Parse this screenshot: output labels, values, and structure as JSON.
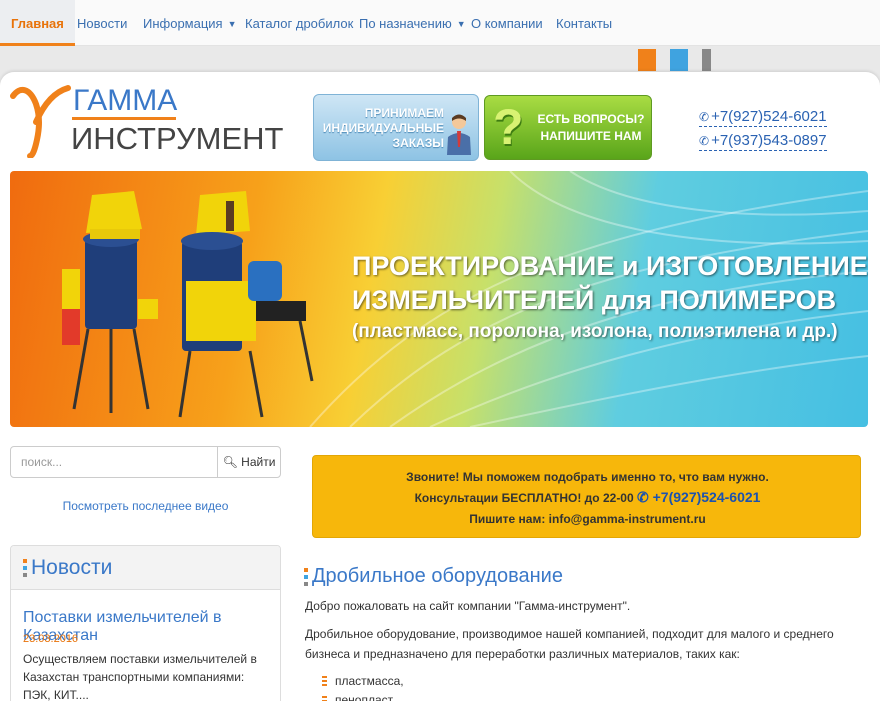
{
  "nav": {
    "items": [
      {
        "label": "Главная",
        "active": true
      },
      {
        "label": "Новости"
      },
      {
        "label": "Информация",
        "dropdown": true
      },
      {
        "label": "Каталог дробилок"
      },
      {
        "label": "По назначению",
        "dropdown": true
      },
      {
        "label": "О компании"
      },
      {
        "label": "Контакты"
      }
    ]
  },
  "logo": {
    "line1": "ГАММА",
    "line2": "ИНСТРУМЕНТ"
  },
  "header_banners": {
    "orders": {
      "line1": "ПРИНИМАЕМ",
      "line2": "ИНДИВИДУАЛЬНЫЕ",
      "line3": "ЗАКАЗЫ"
    },
    "questions": {
      "line1": "ЕСТЬ ВОПРОСЫ?",
      "line2": "НАПИШИТЕ НАМ"
    }
  },
  "phones": [
    "+7(927)524-6021",
    "+7(937)543-0897"
  ],
  "hero": {
    "line1": "ПРОЕКТИРОВАНИЕ и ИЗГОТОВЛЕНИЕ",
    "line2": "ИЗМЕЛЬЧИТЕЛЕЙ для ПОЛИМЕРОВ",
    "line3": "(пластмасс, поролона, изолона, полиэтилена и др.)"
  },
  "search": {
    "placeholder": "поиск...",
    "button_label": "Найти"
  },
  "video_link": "Посмотреть последнее видео",
  "news": {
    "title": "Новости",
    "items": [
      {
        "title": "Поставки измельчителей в Казахстан",
        "date": "23.03.2016",
        "text": "Осуществляем поставки измельчителей  в Казахстан транспортными компаниями: ПЭК, КИТ...."
      }
    ]
  },
  "callout": {
    "line1": "Звоните! Мы поможем подобрать именно то, что вам нужно.",
    "line2_prefix": "Консультации БЕСПЛАТНО! до 22-00",
    "line2_phone": "+7(927)524-6021",
    "line3": "Пишите нам: info@gamma-instrument.ru"
  },
  "main": {
    "title": "Дробильное оборудование",
    "welcome": "Добро пожаловать на сайт компании \"Гамма-инструмент\".",
    "description": "Дробильное оборудование, производимое нашей компанией, подходит для малого и среднего бизнеса и предназначено для переработки различных материалов, таких как:",
    "materials": [
      "пластмасса,",
      "пенопласт,"
    ]
  },
  "colors": {
    "accent_orange": "#f0811a",
    "link_blue": "#3a78c8",
    "callout_yellow": "#f7b70b",
    "strip_colors": [
      "#f0811a",
      "#3fa3e0",
      "#888888"
    ]
  }
}
